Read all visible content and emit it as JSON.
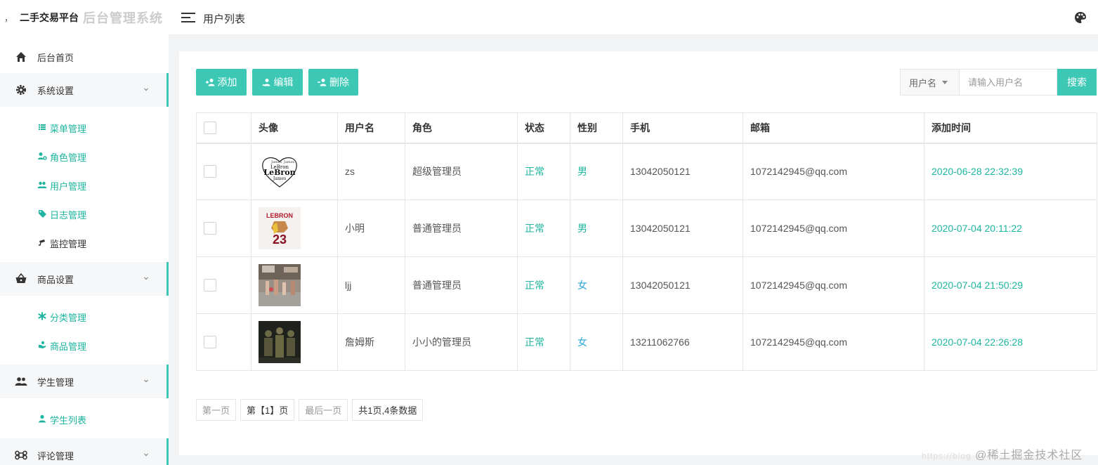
{
  "brand": {
    "dot": "，",
    "name": "二手交易平台",
    "subtitle": "后台管理系统"
  },
  "sidebar": {
    "home": {
      "label": "后台首页",
      "icon": "home-icon"
    },
    "groups": [
      {
        "label": "系统设置",
        "icon": "gear-icon",
        "open": true,
        "items": [
          {
            "label": "菜单管理",
            "icon": "list-icon"
          },
          {
            "label": "角色管理",
            "icon": "user-gear-icon"
          },
          {
            "label": "用户管理",
            "icon": "users-icon"
          },
          {
            "label": "日志管理",
            "icon": "tag-icon"
          },
          {
            "label": "监控管理",
            "icon": "camera-icon"
          }
        ]
      },
      {
        "label": "商品设置",
        "icon": "basket-icon",
        "open": true,
        "items": [
          {
            "label": "分类管理",
            "icon": "asterisk-icon"
          },
          {
            "label": "商品管理",
            "icon": "hand-icon"
          }
        ]
      },
      {
        "label": "学生管理",
        "icon": "group-icon",
        "open": true,
        "items": [
          {
            "label": "学生列表",
            "icon": "person-icon"
          }
        ]
      },
      {
        "label": "评论管理",
        "icon": "command-icon",
        "open": true,
        "items": []
      }
    ]
  },
  "topbar": {
    "title": "用户列表"
  },
  "toolbar": {
    "add": "添加",
    "edit": "编辑",
    "delete": "删除"
  },
  "search": {
    "field": "用户名",
    "placeholder": "请输入用户名",
    "button": "搜索"
  },
  "table": {
    "columns": [
      "",
      "头像",
      "用户名",
      "角色",
      "状态",
      "性别",
      "手机",
      "邮箱",
      "添加时间"
    ],
    "rows": [
      {
        "username": "zs",
        "role": "超级管理员",
        "status": "正常",
        "gender": "男",
        "phone": "13042050121",
        "email": "1072142945@qq.com",
        "created": "2020-06-28 22:32:39",
        "avatar": "lebron-heart-wordcloud"
      },
      {
        "username": "小明",
        "role": "普通管理员",
        "status": "正常",
        "gender": "男",
        "phone": "13042050121",
        "email": "1072142945@qq.com",
        "created": "2020-07-04 20:11:22",
        "avatar": "lebron-23-jersey"
      },
      {
        "username": "ljj",
        "role": "普通管理员",
        "status": "正常",
        "gender": "女",
        "phone": "13042050121",
        "email": "1072142945@qq.com",
        "created": "2020-07-04 21:50:29",
        "avatar": "street-crowd-photo"
      },
      {
        "username": "詹姆斯",
        "role": "小小的管理员",
        "status": "正常",
        "gender": "女",
        "phone": "13211062766",
        "email": "1072142945@qq.com",
        "created": "2020-07-04 22:26:28",
        "avatar": "dark-team-photo"
      }
    ]
  },
  "pagination": {
    "first": "第一页",
    "current": "第【1】页",
    "last": "最后一页",
    "summary": "共1页,4条数据"
  },
  "watermark": {
    "url": "https://blog",
    "text": "@稀土掘金技术社区"
  },
  "colors": {
    "accent": "#3cc8b4",
    "accent_text": "#1db5a0",
    "female": "#2fa5d8"
  }
}
